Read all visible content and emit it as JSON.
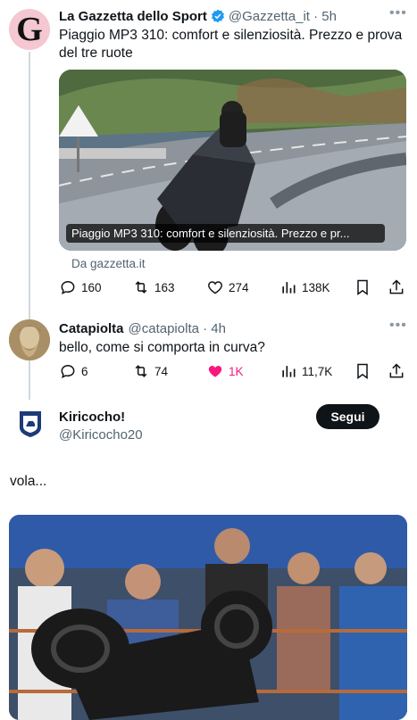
{
  "tweet1": {
    "display_name": "La Gazzetta dello Sport",
    "handle_time": "@Gazzetta_it · 5h",
    "text": "Piaggio MP3 310: comfort e silenziosità. Prezzo e prova del tre ruote",
    "card_title": "Piaggio MP3 310: comfort e silenziosità. Prezzo e pr...",
    "card_source": "Da gazzetta.it",
    "stats": {
      "replies": "160",
      "reposts": "163",
      "likes": "274",
      "views": "138K"
    },
    "avatar_letter": "G",
    "verified": true
  },
  "tweet2": {
    "display_name": "Catapiolta",
    "handle_time": "@catapiolta · 4h",
    "text": "bello, come si comporta in curva?",
    "stats": {
      "replies": "6",
      "reposts": "74",
      "likes": "1K",
      "views": "11,7K"
    },
    "liked": true
  },
  "profile": {
    "display_name": "Kiricocho!",
    "handle": "@Kiricocho20",
    "follow_label": "Segui"
  },
  "post": {
    "text": "vola..."
  },
  "colors": {
    "like_pink": "#f91880",
    "gazzetta_pink": "#f4c7d2",
    "follow_bg": "#0f1419",
    "muted": "#536471"
  },
  "icons": [
    "reply-icon",
    "repost-icon",
    "like-icon",
    "views-icon",
    "bookmark-icon",
    "share-icon",
    "verified-badge-icon",
    "more-icon"
  ]
}
